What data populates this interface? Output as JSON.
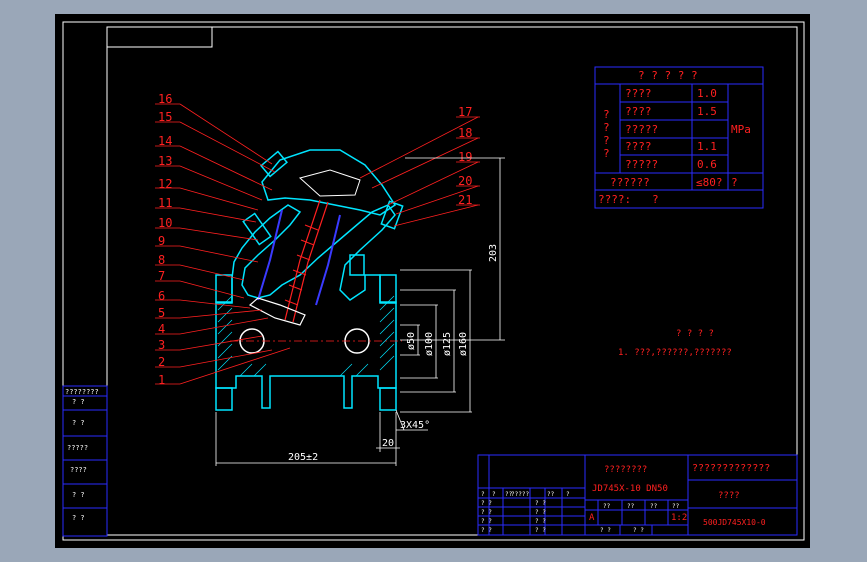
{
  "colors": {
    "background": "#9aa7b8",
    "canvas": "#000000",
    "frame": "#ffffff",
    "table_line": "#2a2cff",
    "text_red": "#ff2020",
    "part_cyan": "#00e5ff",
    "part_blue": "#3a3aff",
    "white": "#ffffff"
  },
  "balloons": [
    "16",
    "15",
    "14",
    "13",
    "12",
    "11",
    "10",
    "9",
    "8",
    "7",
    "6",
    "5",
    "4",
    "3",
    "2",
    "1"
  ],
  "balloons_right": [
    "17",
    "18",
    "19",
    "20",
    "21"
  ],
  "dimensions": {
    "height_203": "203",
    "dia_50": "ø50",
    "dia_100": "ø100",
    "dia_125": "ø125",
    "dia_160": "ø160",
    "chamfer": "3X45°",
    "offset_20": "20",
    "length": "205±2"
  },
  "param_table": {
    "title": "? ? ? ? ?",
    "side_label": [
      "?",
      "?",
      "?",
      "?"
    ],
    "rows": [
      {
        "name": "????",
        "value": "1.0"
      },
      {
        "name": "????",
        "value": "1.5"
      },
      {
        "name": "?????",
        "value": ""
      },
      {
        "name": "????",
        "value": "1.1"
      },
      {
        "name": "?????",
        "value": "0.6"
      }
    ],
    "unit": "MPa",
    "temp_row": {
      "name": "??????",
      "value": "≤80?",
      "unit": "?"
    },
    "medium_row": {
      "name": "????:",
      "value": "?"
    }
  },
  "notes": {
    "title": "? ? ? ?",
    "line1": "1. ???,??????,???????"
  },
  "left_strip": {
    "r1": "????????",
    "r1b": "?   ?",
    "r2": "?   ?",
    "r3": "?????",
    "r4": "????",
    "r5": "?   ?",
    "r6": "?   ?"
  },
  "title_block": {
    "company": "????????",
    "part_no": "JD745X-10  DN50",
    "drawing_name": "?????????????",
    "material": "????",
    "drawing_code": "500JD745X10-0",
    "scale": "1:2",
    "stage": "A",
    "col_heads": [
      "?",
      "?",
      "??",
      "?????",
      "??",
      "?"
    ],
    "sheet_cells": [
      "??",
      "??",
      "??",
      "??"
    ],
    "sign_rows": [
      [
        "? ?",
        "? ?",
        "? ?",
        "? ?"
      ],
      [
        "? ?",
        "? ?",
        "? ?",
        "? ?"
      ],
      [
        "? ?",
        "? ?",
        "? ?",
        "? ?"
      ],
      [
        "? ?",
        "? ?",
        "? ?",
        "? ?"
      ]
    ]
  }
}
